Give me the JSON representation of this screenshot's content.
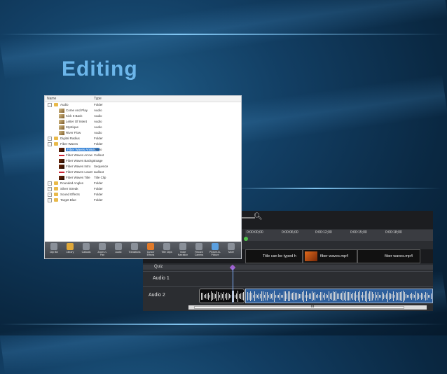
{
  "slide": {
    "title": "Editing"
  },
  "library": {
    "columns": {
      "name": "Name",
      "type": "Type"
    },
    "rows": [
      {
        "name": "Audio",
        "type": "Folder",
        "level": 0,
        "kind": "folder",
        "expanded": true
      },
      {
        "name": "Come And Play",
        "type": "Audio",
        "level": 1,
        "kind": "audio"
      },
      {
        "name": "Kick It Back",
        "type": "Audio",
        "level": 1,
        "kind": "audio"
      },
      {
        "name": "Letter Of Intent",
        "type": "Audio",
        "level": 1,
        "kind": "audio"
      },
      {
        "name": "Mystique",
        "type": "Audio",
        "level": 1,
        "kind": "audio"
      },
      {
        "name": "River Flow",
        "type": "Audio",
        "level": 1,
        "kind": "audio"
      },
      {
        "name": "Digital Radius",
        "type": "Folder",
        "level": 0,
        "kind": "folder"
      },
      {
        "name": "Fiber Waves",
        "type": "Folder",
        "level": 0,
        "kind": "folder",
        "expanded": true
      },
      {
        "name": "Fiber Waves Animat...",
        "type": "Video",
        "level": 1,
        "kind": "media",
        "selected": true
      },
      {
        "name": "Fiber Waves Arrow",
        "type": "Callout",
        "level": 1,
        "kind": "callout"
      },
      {
        "name": "Fiber Waves Backgr...",
        "type": "Image",
        "level": 1,
        "kind": "media"
      },
      {
        "name": "Fiber Waves Intro",
        "type": "Sequence",
        "level": 1,
        "kind": "media"
      },
      {
        "name": "Fiber Waves Lower ...",
        "type": "Callout",
        "level": 1,
        "kind": "callout"
      },
      {
        "name": "Fiber Waves Title",
        "type": "Title Clip",
        "level": 1,
        "kind": "media"
      },
      {
        "name": "Rounded Angles",
        "type": "Folder",
        "level": 0,
        "kind": "folder"
      },
      {
        "name": "Silver Streak",
        "type": "Folder",
        "level": 0,
        "kind": "folder"
      },
      {
        "name": "Sound Effects",
        "type": "Folder",
        "level": 0,
        "kind": "folder"
      },
      {
        "name": "Target Blue",
        "type": "Folder",
        "level": 0,
        "kind": "folder"
      }
    ],
    "toolbar": [
      {
        "label": "Clip Bin",
        "icon": "clip-bin-icon"
      },
      {
        "label": "Library",
        "icon": "library-icon"
      },
      {
        "label": "Callouts",
        "icon": "callouts-icon"
      },
      {
        "label": "Zoom-n-Pan",
        "icon": "zoom-pan-icon"
      },
      {
        "label": "Audio",
        "icon": "audio-icon"
      },
      {
        "label": "Transitions",
        "icon": "transitions-icon"
      },
      {
        "label": "Cursor Effects",
        "icon": "cursor-effects-icon"
      },
      {
        "label": "Title Clips",
        "icon": "title-clips-icon"
      },
      {
        "label": "Voice Narration",
        "icon": "voice-narration-icon"
      },
      {
        "label": "Record Camera",
        "icon": "record-camera-icon"
      },
      {
        "label": "Picture-in-Picture",
        "icon": "pip-icon"
      },
      {
        "label": "More",
        "icon": "more-icon"
      }
    ]
  },
  "timeline": {
    "ruler_ticks": [
      "0:00:00;00",
      "0:00:06;00",
      "0:00:12;00",
      "0:00:15;00",
      "0:00:18;00"
    ],
    "clips": [
      {
        "label": "Title can be typed h"
      },
      {
        "label": "fiber waves.mp4"
      },
      {
        "label": "fiber waves.mp4"
      }
    ],
    "quiz_label": "Quiz",
    "tracks": [
      "Audio 1",
      "Audio 2"
    ],
    "scrollbar_label": "III",
    "colors": {
      "playhead": "#7fb0ff",
      "quiz_marker": "#a060d0",
      "audio_selected": "#2e5f9c"
    }
  }
}
